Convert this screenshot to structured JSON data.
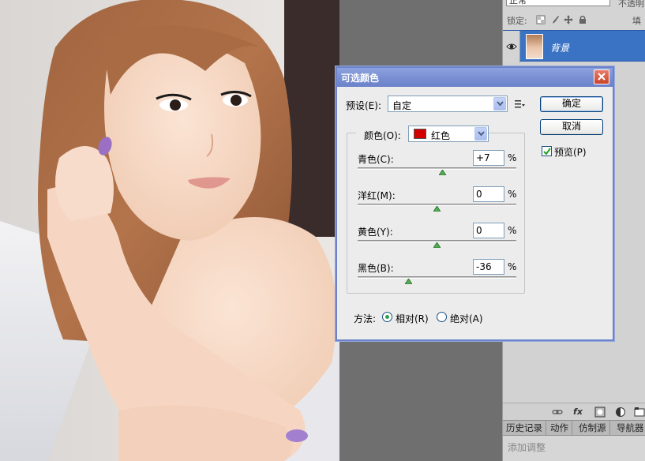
{
  "layers_panel": {
    "blend_mode": "正常",
    "opacity_label": "不透明",
    "lock_label": "锁定:",
    "fill_label": "填",
    "layer_name": "背景"
  },
  "panel_tabs": [
    "历史记录",
    "动作",
    "仿制源",
    "导航器"
  ],
  "adjustments_label": "添加调整",
  "dialog": {
    "title": "可选颜色",
    "preset_label": "预设(E):",
    "preset_value": "自定",
    "ok_label": "确定",
    "cancel_label": "取消",
    "preview_label": "预览(P)",
    "preview_checked": true,
    "color_label": "颜色(O):",
    "color_value": "红色",
    "color_swatch": "#d40000",
    "sliders": [
      {
        "label": "青色(C):",
        "value": "+7",
        "percent": 7
      },
      {
        "label": "洋红(M):",
        "value": "0",
        "percent": 0
      },
      {
        "label": "黄色(Y):",
        "value": "0",
        "percent": 0
      },
      {
        "label": "黑色(B):",
        "value": "-36",
        "percent": -36
      }
    ],
    "percent_sign": "%",
    "method_label": "方法:",
    "methods": [
      {
        "label": "相对(R)",
        "selected": true
      },
      {
        "label": "绝对(A)",
        "selected": false
      }
    ]
  }
}
